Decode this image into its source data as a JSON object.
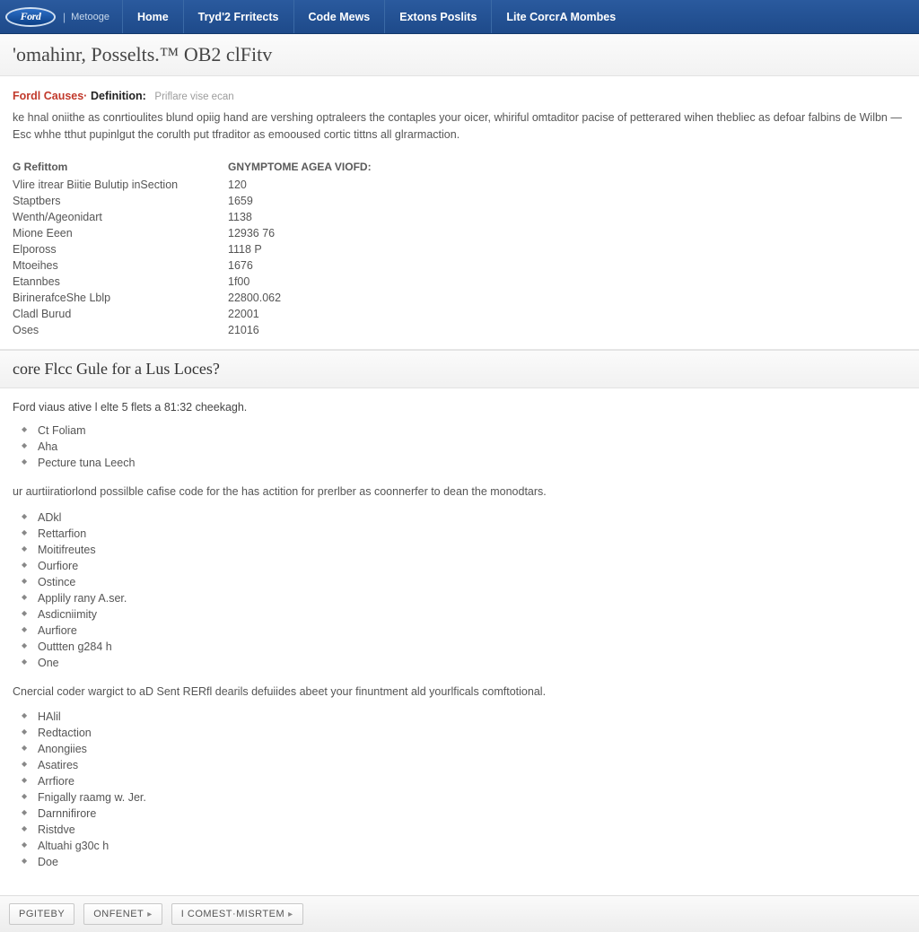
{
  "header": {
    "logo_text": "Ford",
    "logo_sub": "Metooge",
    "nav": [
      "Home",
      "Tryd'2 Frritects",
      "Code Mews",
      "Extons Poslits",
      "Lite CorcrA Mombes"
    ]
  },
  "page": {
    "title": "'omahinr, Posselts.™ OB2 clFitv"
  },
  "definition": {
    "label": "Fordl Causes·",
    "bold": "Definition:",
    "hint": "Priflare vise ecan",
    "body": "ke hnal oniithe as conrtioulites blund opiig hand are vershing optraleers the contaples your oicer, whiriful omtaditor pacise of petterared wihen thebliec as defoar falbins de Wilbn — Esc whhe tthut pupinlgut the corulth put tfraditor as emooused cortic tittns all glrarmaction."
  },
  "table": {
    "head_left": "G Refittom",
    "head_right": "GNYMPTOME AGEA VIOFD:",
    "rows": [
      {
        "l": "Vlire itrear Biitie Bulutip inSection",
        "r": "120"
      },
      {
        "l": "Staptbers",
        "r": "1659"
      },
      {
        "l": "Wenth/Ageonidart",
        "r": "1138"
      },
      {
        "l": "Mione Eeen",
        "r": "12936 76"
      },
      {
        "l": "Elpoross",
        "r": "1118 P"
      },
      {
        "l": "Mtoeihes",
        "r": "1676"
      },
      {
        "l": "Etannbes",
        "r": "1f00"
      },
      {
        "l": "BirinerafceShe Lblp",
        "r": "22800.062"
      },
      {
        "l": "Cladl Burud",
        "r": "22001"
      },
      {
        "l": "Oses",
        "r": "21016"
      }
    ]
  },
  "section2": {
    "heading": "core Flcc Gule for a Lus Loces?",
    "intro": "Ford viaus ative l elte 5 flets a 81:32 cheekagh.",
    "list1": [
      "Ct Foliam",
      "Aha",
      "Pecture tuna Leech"
    ],
    "para1": "ur aurtiiratiorlond possilble cafise code for the has actition for prerlber as coonnerfer to dean the monodtars.",
    "list2": [
      "ADkl",
      "Rettarfion",
      "Moitifreutes",
      "Ourfiore",
      "Ostince",
      "Applily rany A.ser.",
      "Asdicniimity",
      "Aurfiore",
      "Outtten g284 h",
      "One"
    ],
    "para2": "Cnercial coder wargict to aD Sent RERfl dearils defuiides abeet your finuntment ald yourlficals comftotional.",
    "list3": [
      "HAlil",
      "Redtaction",
      "Anongiies",
      "Asatires",
      "Arrfiore",
      "Fnigally raamg w. Jer.",
      "Darnnifirore",
      "Ristdve",
      "Altuahi g30c h",
      "Doe"
    ]
  },
  "footer": {
    "buttons": [
      {
        "label": "PGITEBY",
        "chev": ""
      },
      {
        "label": "ONFENET",
        "chev": "▸"
      },
      {
        "label": "I COMEST·MISRTEM",
        "chev": "▸"
      }
    ]
  }
}
